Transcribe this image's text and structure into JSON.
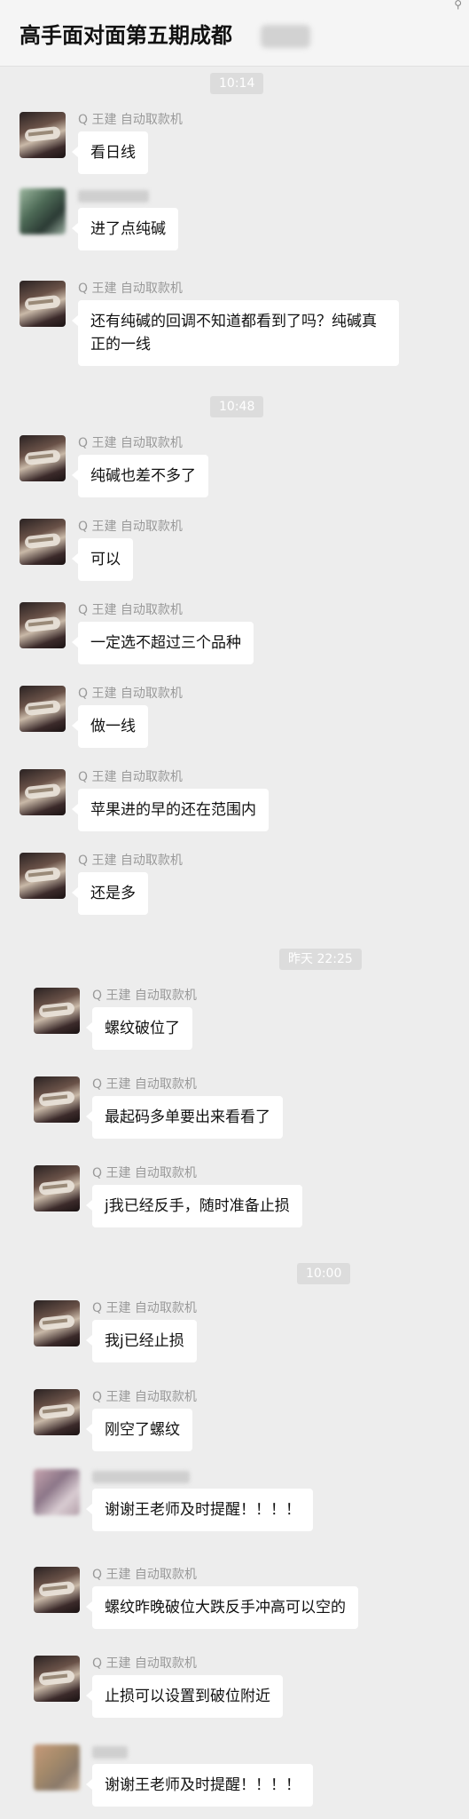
{
  "header": {
    "title": "高手面对面第五期成都",
    "pin_icon": "pin-icon"
  },
  "sender": {
    "name": "Q 王建 自动取款机"
  },
  "timestamps": [
    "10:14",
    "10:48",
    "昨天 22:25",
    "10:00"
  ],
  "messages": [
    {
      "text": "看日线"
    },
    {
      "text": "进了点纯碱"
    },
    {
      "text": "还有纯碱的回调不知道都看到了吗？纯碱真正的一线"
    },
    {
      "text": "纯碱也差不多了"
    },
    {
      "text": "可以"
    },
    {
      "text": "一定选不超过三个品种"
    },
    {
      "text": "做一线"
    },
    {
      "text": "苹果进的早的还在范围内"
    },
    {
      "text": "还是多"
    },
    {
      "text": "螺纹破位了"
    },
    {
      "text": "最起码多单要出来看看了"
    },
    {
      "text": "j我已经反手，随时准备止损"
    },
    {
      "text": "我j已经止损"
    },
    {
      "text": "刚空了螺纹"
    },
    {
      "text": "谢谢王老师及时提醒！！！！"
    },
    {
      "text": "螺纹昨晚破位大跌反手冲高可以空的"
    },
    {
      "text": "止损可以设置到破位附近"
    },
    {
      "text": "谢谢王老师及时提醒！！！！"
    }
  ]
}
